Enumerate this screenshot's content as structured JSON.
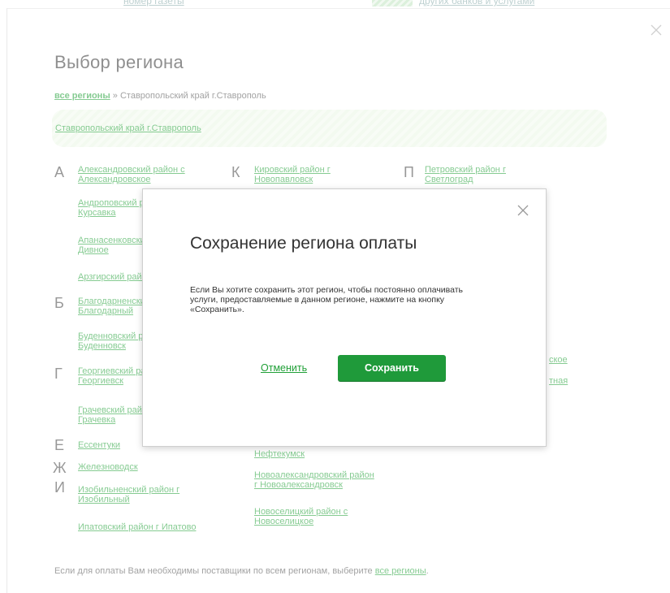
{
  "top_strip": {
    "left_text": "номер газеты",
    "right_text": "других банков и услугами"
  },
  "page": {
    "title": "Выбор региона",
    "close_icon": "close-icon"
  },
  "breadcrumb": {
    "root_link": "все регионы",
    "separator": "»",
    "current": "Ставропольский край г.Ставрополь"
  },
  "selected": {
    "label": "Ставропольский край г.Ставрополь"
  },
  "letters": [
    "А",
    "Б",
    "Г",
    "Е",
    "Ж",
    "И",
    "К",
    "П"
  ],
  "regions": {
    "a1": [
      "Александровский район с",
      "Александровское"
    ],
    "a2": [
      "Андроповский район с",
      "Курсавка"
    ],
    "a3": [
      "Апанасенковский район с",
      "Дивное"
    ],
    "a4": [
      "Арзгирский район с Арзгир"
    ],
    "b1": [
      "Благодарненский район г",
      "Благодарный"
    ],
    "b2": [
      "Буденновский район г",
      "Буденновск"
    ],
    "g1": [
      "Георгиевский район г",
      "Георгиевск"
    ],
    "g2": [
      "Грачевский район с",
      "Грачевка"
    ],
    "e1": [
      "Ессентуки"
    ],
    "zh1": [
      "Железноводск"
    ],
    "i1": [
      "Изобильненский район г",
      "Изобильный"
    ],
    "i2": [
      "Ипатовский район г Ипатово"
    ],
    "k1": [
      "Кировский район г",
      "Новопавловск"
    ],
    "n1": [
      "Нефтекумск"
    ],
    "n2": [
      "Новоалександровский район",
      "г Новоалександровск"
    ],
    "n3": [
      "Новоселицкий район с",
      "Новоселицкое"
    ],
    "p1": [
      "Петровский район г",
      "Светлоград"
    ],
    "r_partial1": "ское",
    "r_partial2": "тная"
  },
  "footer": {
    "text": "Если для оплаты Вам необходимы поставщики по всем регионам, выберите",
    "link": "все регионы",
    "end": "."
  },
  "modal": {
    "title": "Сохранение региона оплаты",
    "body": "Если Вы хотите сохранить этот регион, чтобы постоянно оплачивать услуги, предоставляемые в данном регионе, нажмите на кнопку «Сохранить».",
    "cancel_label": "Отменить",
    "save_label": "Сохранить",
    "close_icon": "close-icon"
  },
  "colors": {
    "accent": "#21a038",
    "button": "#1f9a3a",
    "selected_bg": "#eef8e9"
  }
}
